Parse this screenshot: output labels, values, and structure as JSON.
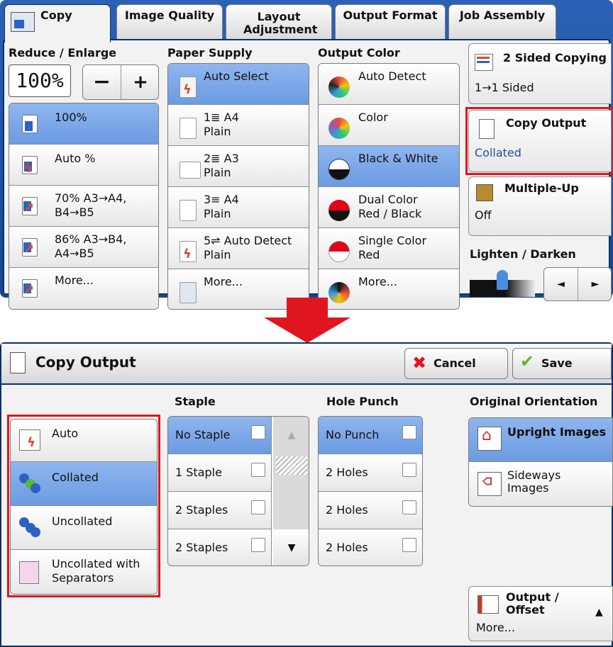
{
  "top": {
    "tabs": [
      "Copy",
      "Image Quality",
      "Layout Adjustment",
      "Output Format",
      "Job Assembly"
    ],
    "reduce_enlarge": {
      "label": "Reduce / Enlarge",
      "value": "100",
      "unit": "%",
      "minus": "−",
      "plus": "+",
      "options": [
        "100%",
        "Auto %",
        "70% A3→A4,\nB4→B5",
        "86% A3→B4,\nA4→B5",
        "More..."
      ]
    },
    "paper_supply": {
      "label": "Paper Supply",
      "options": [
        "Auto Select",
        "1≣ A4\nPlain",
        "2≣ A3\nPlain",
        "3≡ A4\nPlain",
        "5⇌ Auto Detect\nPlain",
        "More..."
      ]
    },
    "output_color": {
      "label": "Output Color",
      "options": [
        "Auto Detect",
        "Color",
        "Black & White",
        "Dual Color\nRed / Black",
        "Single Color\nRed",
        "More..."
      ]
    },
    "two_sided": {
      "title": "2 Sided Copying",
      "value": "1→1 Sided"
    },
    "copy_output": {
      "title": "Copy Output",
      "value": "Collated"
    },
    "multiple_up": {
      "title": "Multiple-Up",
      "value": "Off"
    },
    "lighten_darken": {
      "label": "Lighten / Darken",
      "left": "◄",
      "right": "►"
    }
  },
  "bottom": {
    "title": "Copy Output",
    "cancel": "Cancel",
    "save": "Save",
    "output_options": [
      "Auto",
      "Collated",
      "Uncollated",
      "Uncollated with\nSeparators"
    ],
    "staple": {
      "label": "Staple",
      "options": [
        "No Staple",
        "1 Staple",
        "2 Staples",
        "2 Staples"
      ]
    },
    "hole_punch": {
      "label": "Hole Punch",
      "options": [
        "No Punch",
        "2 Holes",
        "2 Holes",
        "2 Holes"
      ]
    },
    "orientation": {
      "label": "Original Orientation",
      "options": [
        "Upright Images",
        "Sideways\nImages"
      ]
    },
    "output_offset": {
      "label": "Output /\nOffset",
      "value": "More..."
    }
  },
  "colors": {
    "selected": "#7ba7ea",
    "highlight": "#e0161e",
    "brand_blue": "#1f4f9e"
  }
}
